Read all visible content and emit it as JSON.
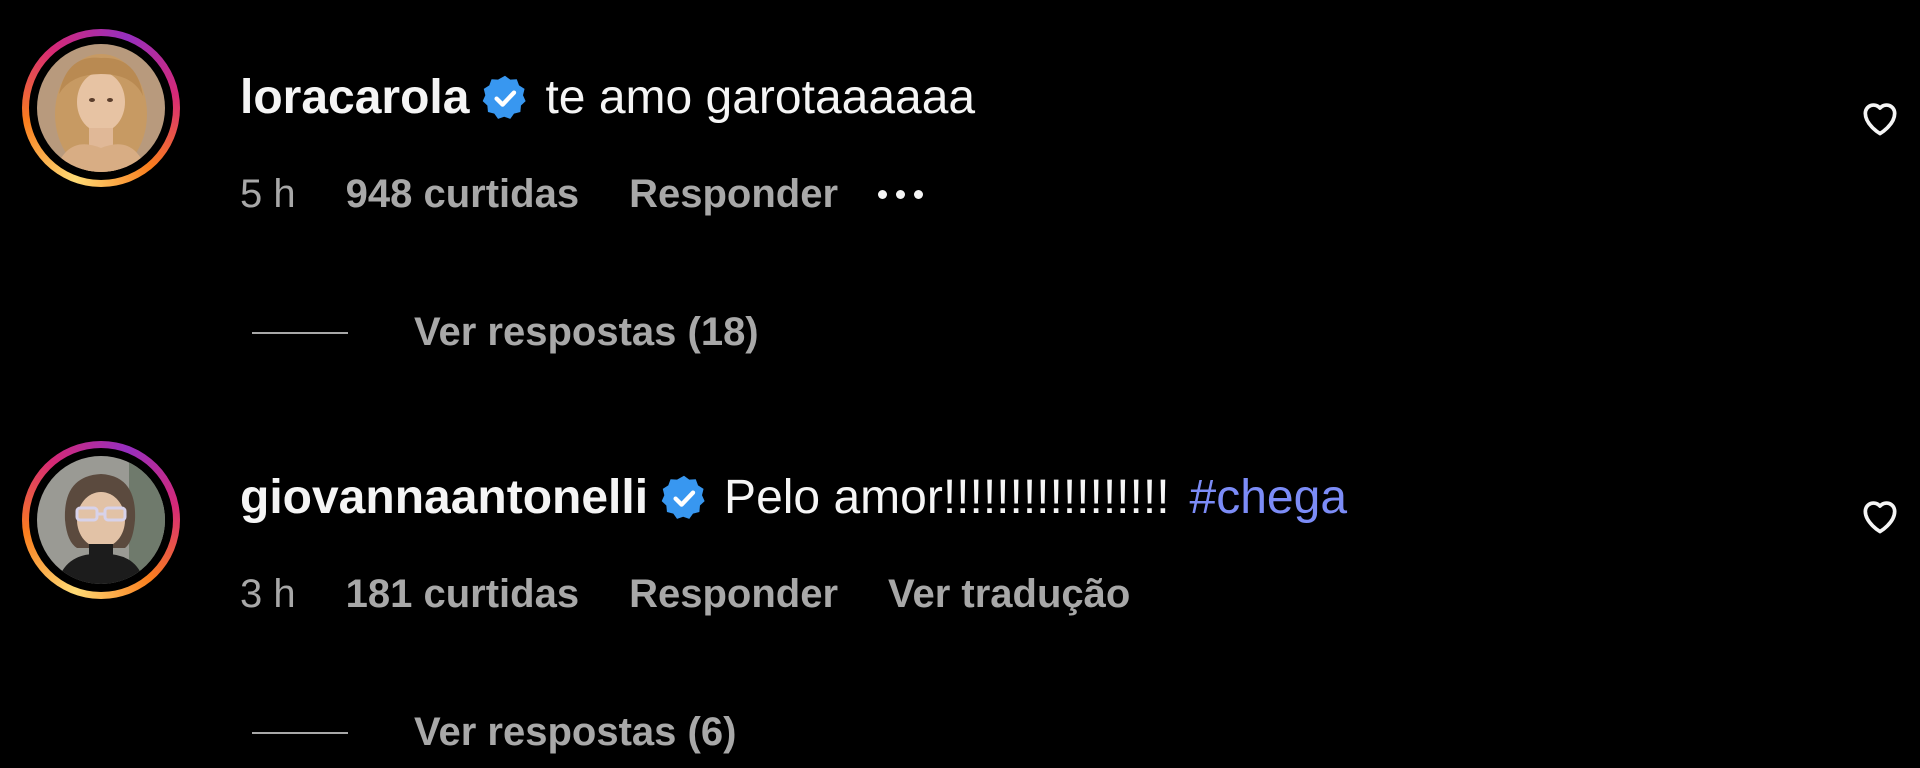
{
  "comments": [
    {
      "username": "loracarola",
      "verified": true,
      "text": "te amo garotaaaaaa",
      "time": "5 h",
      "likes": "948 curtidas",
      "reply_label": "Responder",
      "more_icon": "ellipsis-icon",
      "view_replies": "Ver respostas (18)"
    },
    {
      "username": "giovannaantonelli",
      "verified": true,
      "text": "Pelo amor!!!!!!!!!!!!!!!!!",
      "hashtag": "#chega",
      "time": "3 h",
      "likes": "181 curtidas",
      "reply_label": "Responder",
      "translate_label": "Ver tradução",
      "view_replies": "Ver respostas (6)"
    }
  ],
  "colors": {
    "background": "#000000",
    "text": "#f5f5f5",
    "muted": "#a8a8a8",
    "verified": "#3897f0",
    "hashtag": "#7c8cf7"
  }
}
